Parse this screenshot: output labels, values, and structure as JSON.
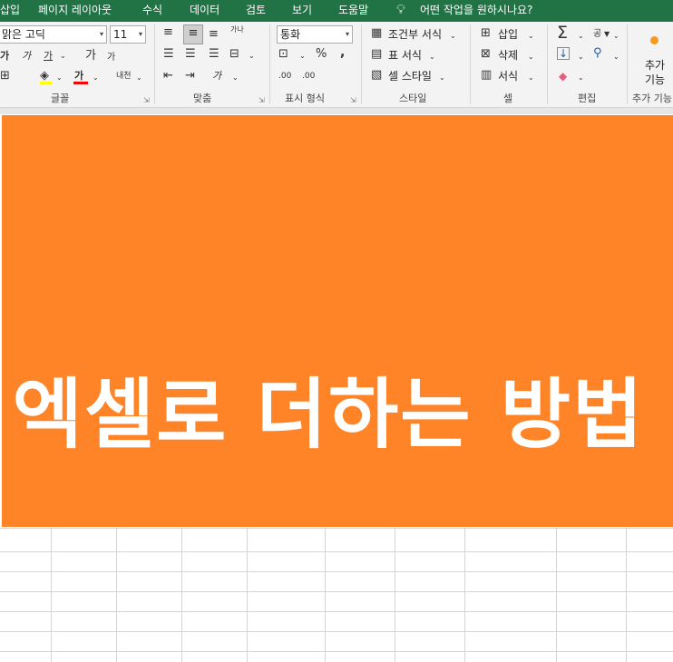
{
  "menu": {
    "tabs": [
      "삽입",
      "페이지 레이아웃",
      "수식",
      "데이터",
      "검토",
      "보기",
      "도움말"
    ],
    "tell_me": "어떤 작업을 원하시나요?"
  },
  "ribbon": {
    "font": {
      "font_name": "맑은 고딕",
      "font_size": "11",
      "bold_glyph": "가",
      "italic_glyph": "가",
      "underline_glyph": "가",
      "grow_glyph": "가",
      "shrink_glyph": "가",
      "font_color_glyph": "가",
      "phonetic_glyph": "내천",
      "group_label": "글꼴"
    },
    "alignment": {
      "wrap_glyph": "가나",
      "orientation_glyph": "가",
      "group_label": "맞춤"
    },
    "number": {
      "format": "통화",
      "percent": "%",
      "comma": ",",
      "increase_decimal": ".00",
      "decrease_decimal": ".00",
      "group_label": "표시 형식"
    },
    "styles": {
      "conditional": "조건부 서식",
      "format_table": "표 서식",
      "cell_styles": "셀 스타일",
      "group_label": "스타일"
    },
    "cells": {
      "insert": "삽입",
      "delete": "삭제",
      "format": "서식",
      "group_label": "셀"
    },
    "editing": {
      "sort_glyph": "공",
      "group_label": "편집"
    },
    "addins": {
      "label_line1": "추가",
      "label_line2": "기능",
      "group_label": "추가 기능"
    }
  },
  "banner": {
    "title": "엑셀로 더하는 방법",
    "color": "#FE8427"
  },
  "colors": {
    "menubar": "#217346",
    "highlight_yellow": "#FFFF00",
    "font_red": "#FF0000"
  }
}
